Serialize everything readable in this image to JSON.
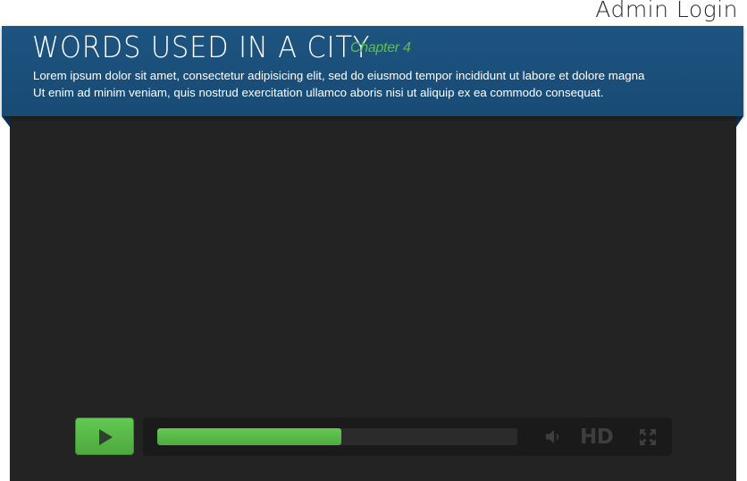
{
  "header": {
    "admin_login": "Admin Login",
    "title": "WORDS USED IN A CITY",
    "chapter": "Chapter 4",
    "description_line1": "Lorem ipsum dolor sit amet, consectetur adipisicing elit, sed do eiusmod tempor incididunt ut labore et dolore magna",
    "description_line2": "Ut enim ad minim veniam, quis nostrud exercitation ullamco  aboris nisi ut aliquip ex ea commodo consequat."
  },
  "player": {
    "progress_percent": 51,
    "hd_label": "HD",
    "icons": {
      "play": "play-icon",
      "volume": "volume-icon",
      "fullscreen": "fullscreen-icon"
    }
  },
  "colors": {
    "banner": "#1b5079",
    "accent_green": "#5ec14b",
    "video_background": "#232323"
  }
}
